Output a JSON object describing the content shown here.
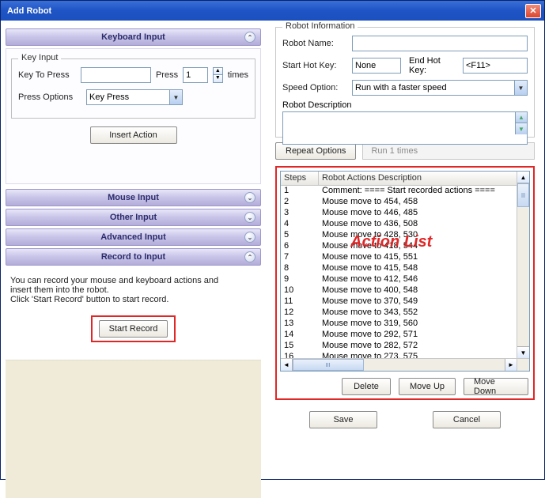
{
  "window": {
    "title": "Add Robot"
  },
  "accordion": {
    "keyboard": "Keyboard Input",
    "mouse": "Mouse Input",
    "other": "Other Input",
    "advanced": "Advanced Input",
    "record": "Record to Input"
  },
  "keyInput": {
    "legend": "Key Input",
    "keyToPress": "Key To Press",
    "press": "Press",
    "pressValue": "1",
    "times": "times",
    "pressOptions": "Press Options",
    "pressOptionsValue": "Key Press",
    "insertAction": "Insert Action"
  },
  "record": {
    "desc1": "You can record your mouse and keyboard actions and",
    "desc2": "insert them into the robot.",
    "desc3": "Click 'Start Record' button to start record.",
    "startRecord": "Start Record"
  },
  "robotInfo": {
    "legend": "Robot Information",
    "name": "Robot Name:",
    "startHotKey": "Start Hot Key:",
    "startValue": "None",
    "endHotKey": "End Hot Key:",
    "endValue": "<F11>",
    "speedOption": "Speed Option:",
    "speedValue": "Run with a faster speed",
    "desc": "Robot Description"
  },
  "repeat": {
    "button": "Repeat Options",
    "text": "Run 1 times"
  },
  "listHead": {
    "steps": "Steps",
    "actions": "Robot Actions Description"
  },
  "actions": [
    {
      "n": "1",
      "d": "Comment: ==== Start recorded actions ===="
    },
    {
      "n": "2",
      "d": "Mouse move to 454, 458"
    },
    {
      "n": "3",
      "d": "Mouse move to 446, 485"
    },
    {
      "n": "4",
      "d": "Mouse move to 436, 508"
    },
    {
      "n": "5",
      "d": "Mouse move to 428, 530"
    },
    {
      "n": "6",
      "d": "Mouse move to 418, 544"
    },
    {
      "n": "7",
      "d": "Mouse move to 415, 551"
    },
    {
      "n": "8",
      "d": "Mouse move to 415, 548"
    },
    {
      "n": "9",
      "d": "Mouse move to 412, 546"
    },
    {
      "n": "10",
      "d": "Mouse move to 400, 548"
    },
    {
      "n": "11",
      "d": "Mouse move to 370, 549"
    },
    {
      "n": "12",
      "d": "Mouse move to 343, 552"
    },
    {
      "n": "13",
      "d": "Mouse move to 319, 560"
    },
    {
      "n": "14",
      "d": "Mouse move to 292, 571"
    },
    {
      "n": "15",
      "d": "Mouse move to 282, 572"
    },
    {
      "n": "16",
      "d": "Mouse move to 273, 575"
    }
  ],
  "listBtns": {
    "delete": "Delete",
    "moveUp": "Move Up",
    "moveDown": "Move Down"
  },
  "dialog": {
    "save": "Save",
    "cancel": "Cancel"
  },
  "annotation": "Action List"
}
